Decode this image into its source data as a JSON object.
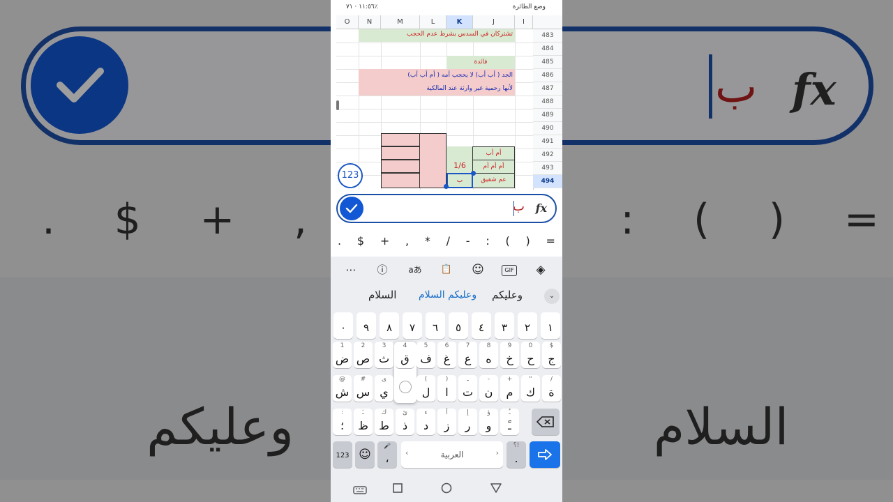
{
  "status": {
    "time": "١١:٥٦",
    "battery": "٧١٪",
    "mode": "وضع الطائرة"
  },
  "sheet": {
    "columns": [
      "O",
      "N",
      "M",
      "L",
      "K",
      "J",
      "I"
    ],
    "selected_column": "K",
    "rows": [
      "483",
      "484",
      "485",
      "486",
      "487",
      "488",
      "489",
      "490",
      "491",
      "492",
      "493",
      "494"
    ],
    "selected_row": "494",
    "cells": {
      "r483": "تشتركان في السدس بشرط عدم الحجب",
      "r485": "فائدة",
      "r486": "الجد ( أب أب) لا يحجب أمه ( أم أب أب)",
      "r487": "لأنها رحمية غير وارثة عند المالكية",
      "r492_j": "أم أب",
      "r493_j": "أم أم أم",
      "r493_k": "1/6",
      "r494_j": "عم شقيق",
      "r494_k": "ب"
    },
    "badge": "123"
  },
  "formula_bar": {
    "value": "ب",
    "fx_label": "fx"
  },
  "symbols": [
    ".",
    "$",
    "+",
    ",",
    "*",
    "/",
    "-",
    ":",
    "(",
    ")",
    "="
  ],
  "toolbar": {
    "more": "⋯",
    "info": "ⓘ",
    "translate": "aあ",
    "clipboard": "📋",
    "sticker": "☺",
    "gif": "GIF",
    "copilot": "◈"
  },
  "suggestions": [
    "السلام",
    "وعليكم السلام",
    "وعليكم"
  ],
  "keyboard": {
    "numbers": [
      "١",
      "٢",
      "٣",
      "٤",
      "٥",
      "٦",
      "٧",
      "٨",
      "٩",
      "٠"
    ],
    "row1": [
      [
        "ض",
        "1"
      ],
      [
        "ص",
        "2"
      ],
      [
        "ث",
        "3"
      ],
      [
        "ق",
        "4"
      ],
      [
        "ف",
        "5"
      ],
      [
        "غ",
        "6"
      ],
      [
        "ع",
        "7"
      ],
      [
        "ه",
        "8"
      ],
      [
        "خ",
        "9"
      ],
      [
        "ح",
        "0"
      ],
      [
        "ج",
        "$"
      ]
    ],
    "row2": [
      [
        "ش",
        "@"
      ],
      [
        "س",
        "#"
      ],
      [
        "ي",
        "ى"
      ],
      [
        "ب",
        ""
      ],
      [
        "ل",
        "("
      ],
      [
        "ا",
        ")"
      ],
      [
        "ت",
        "ـ"
      ],
      [
        "ن",
        "-"
      ],
      [
        "م",
        "+"
      ],
      [
        "ك",
        "\""
      ],
      [
        "ة",
        "/"
      ]
    ],
    "row3": [
      [
        "؛",
        ":"
      ],
      [
        "ظ",
        "ـَ"
      ],
      [
        "ط",
        "ك"
      ],
      [
        "ذ",
        "ئ"
      ],
      [
        "د",
        "ء"
      ],
      [
        "ز",
        "أ"
      ],
      [
        "ر",
        "إ"
      ],
      [
        "و",
        "ؤ"
      ],
      [
        "ـً",
        "ـُ"
      ]
    ],
    "popup_letter": "ب",
    "mode_key": "123",
    "emoji_key": "☺",
    "comma_key": "،",
    "space_label": "العربية",
    "period_key": ".",
    "period_hint": "؟!",
    "enter_key": "↵"
  }
}
